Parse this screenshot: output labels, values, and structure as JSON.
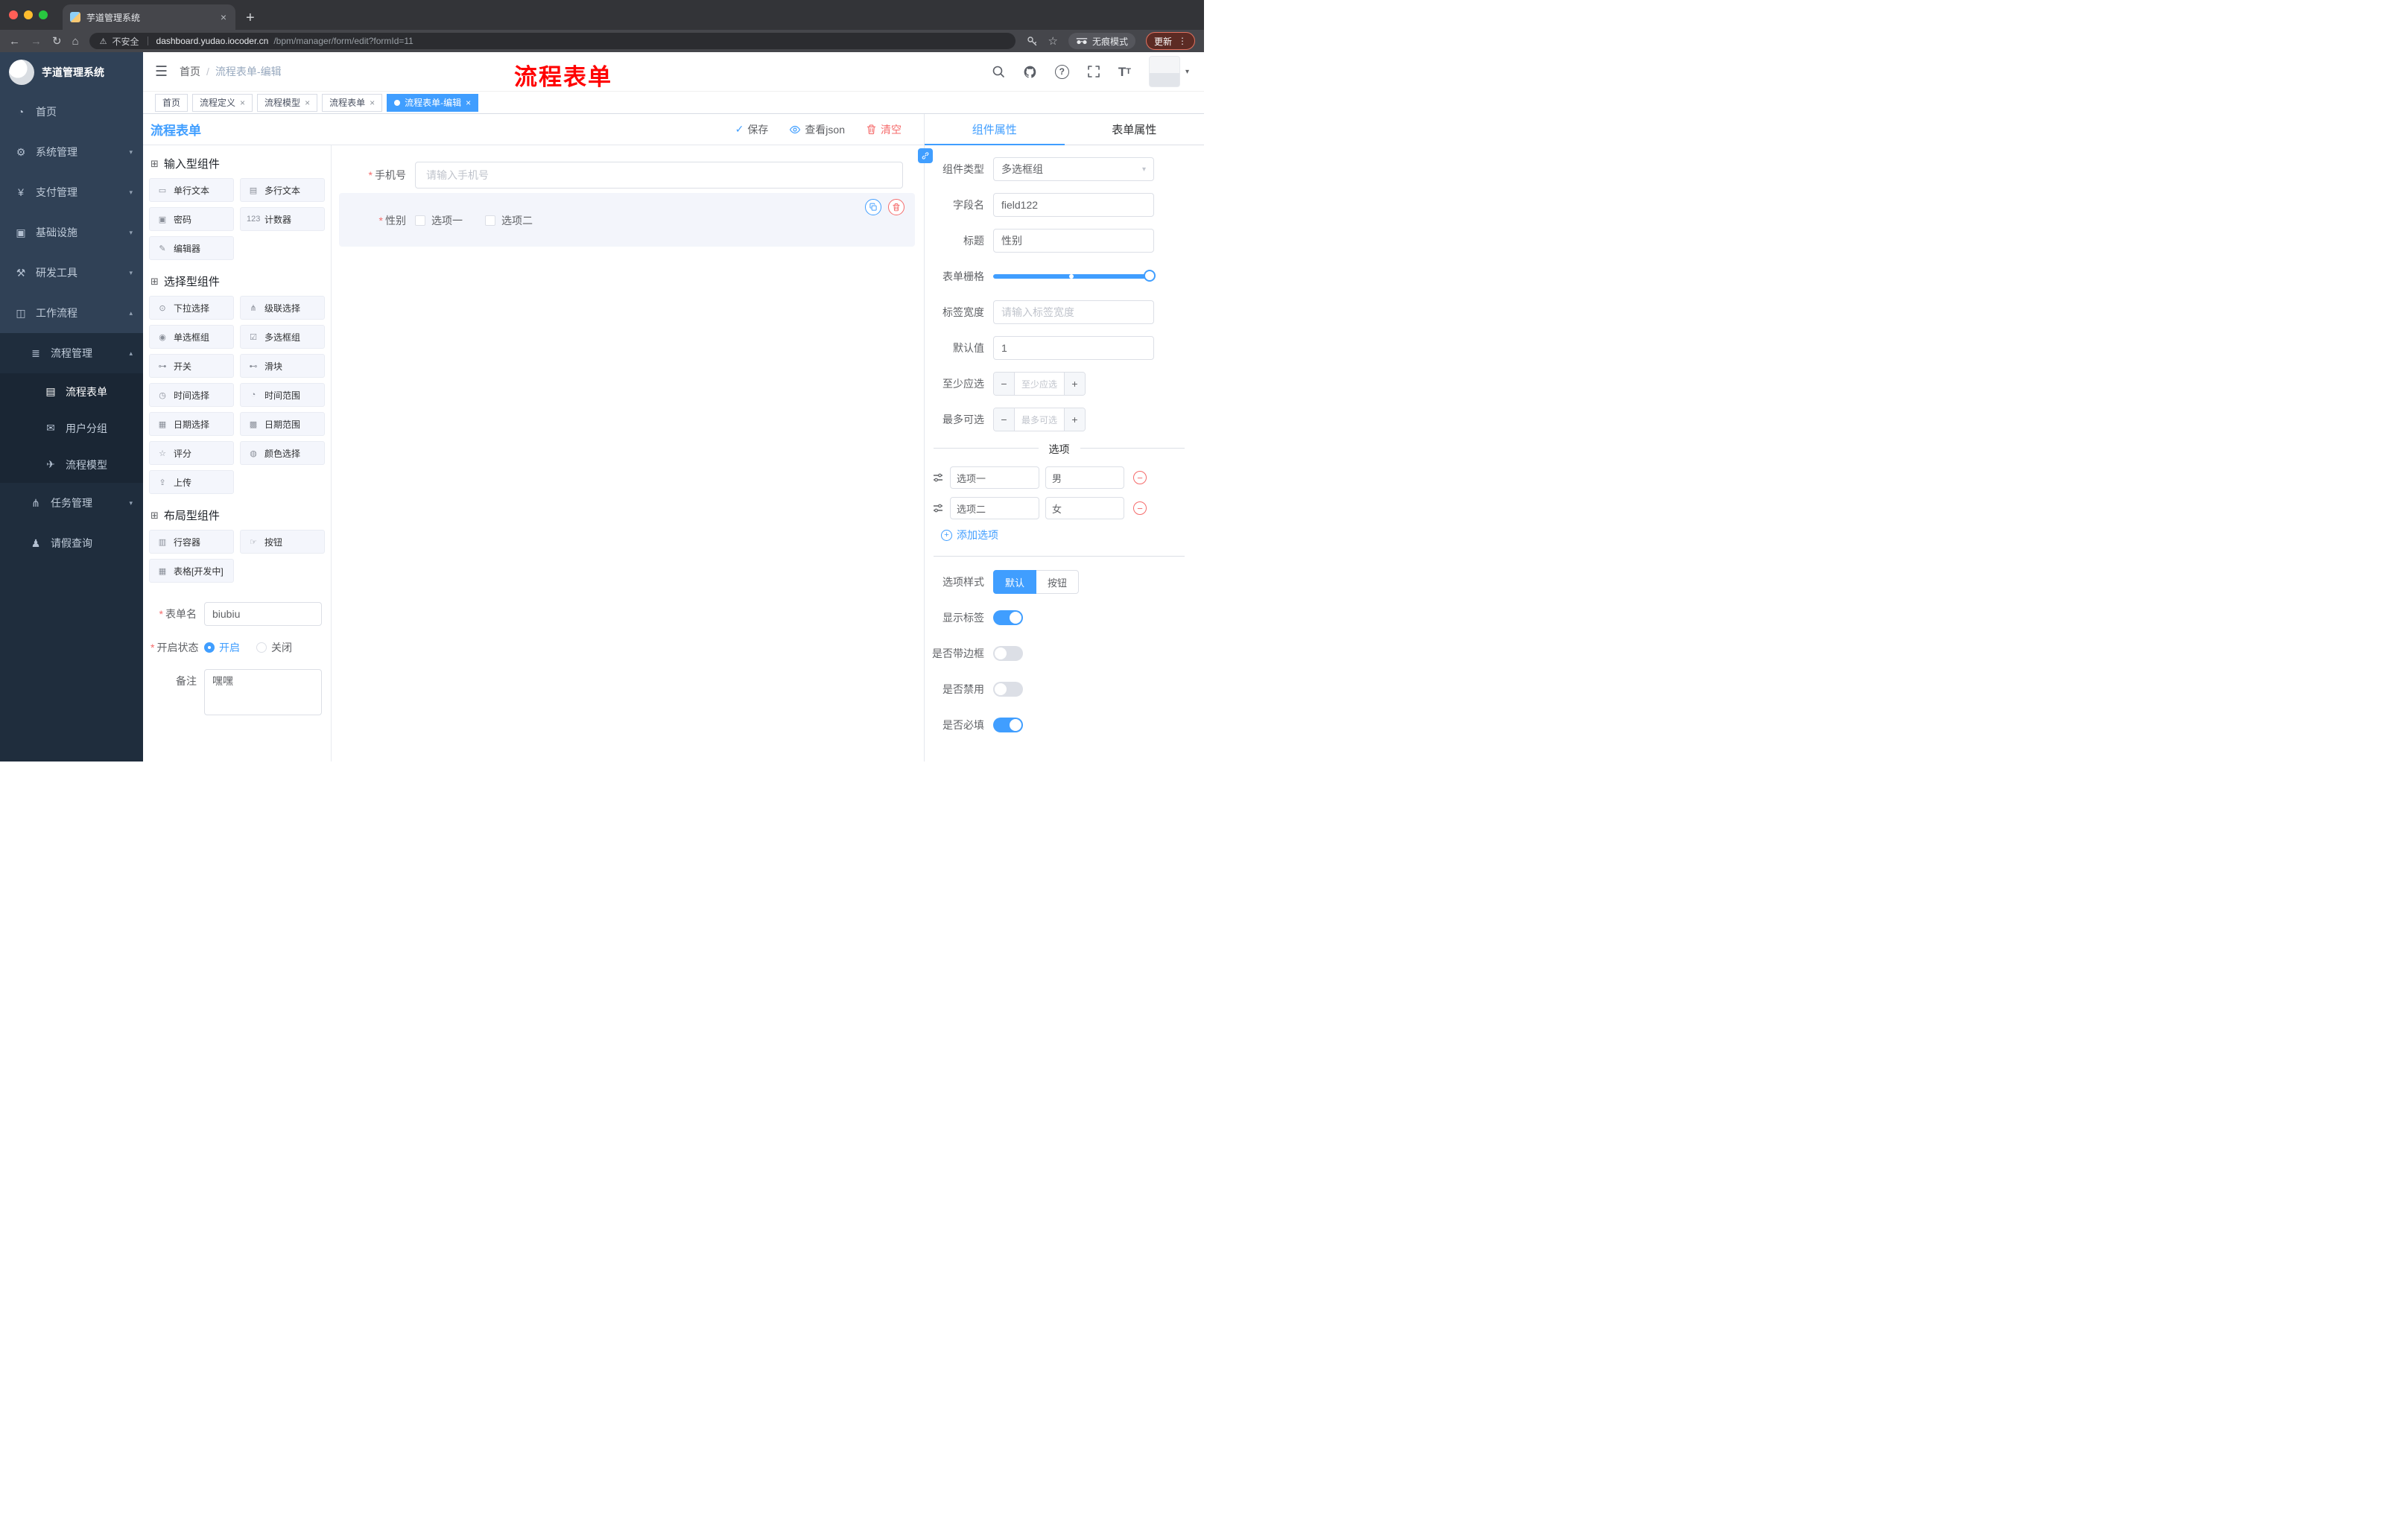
{
  "colors": {
    "accent": "#409eff",
    "danger": "#f56c6c",
    "annotation_red": "#ff0000",
    "sidebar_bg": "#304156",
    "submenu_bg": "#1f2d3d"
  },
  "browser": {
    "tab_title": "芋道管理系统",
    "security_label": "不安全",
    "url_host": "dashboard.yudao.iocoder.cn",
    "url_path": "/bpm/manager/form/edit?formId=11",
    "incognito_label": "无痕模式",
    "update_label": "更新"
  },
  "sidebar": {
    "logo_title": "芋道管理系统",
    "menu": [
      {
        "label": "首页",
        "glyph": "◔"
      },
      {
        "label": "系统管理",
        "glyph": "⚙"
      },
      {
        "label": "支付管理",
        "glyph": "¥"
      },
      {
        "label": "基础设施",
        "glyph": "▣"
      },
      {
        "label": "研发工具",
        "glyph": "⚒"
      },
      {
        "label": "工作流程",
        "glyph": "◫"
      }
    ],
    "submenu": {
      "group_label": "流程管理",
      "group_glyph": "≣",
      "children": [
        {
          "label": "流程表单",
          "glyph": "▤"
        },
        {
          "label": "用户分组",
          "glyph": "✉"
        },
        {
          "label": "流程模型",
          "glyph": "✈"
        }
      ],
      "task_label": "任务管理",
      "task_glyph": "⋔",
      "leave_label": "请假查询",
      "leave_glyph": "♟"
    }
  },
  "header": {
    "breadcrumb_home": "首页",
    "breadcrumb_current": "流程表单-编辑",
    "overlay_title": "流程表单"
  },
  "tags": [
    {
      "label": "首页"
    },
    {
      "label": "流程定义"
    },
    {
      "label": "流程模型"
    },
    {
      "label": "流程表单"
    },
    {
      "label": "流程表单-编辑"
    }
  ],
  "designer": {
    "panel_title": "流程表单",
    "save_label": "保存",
    "view_json_label": "查看json",
    "clear_label": "清空",
    "palette": {
      "groups": [
        {
          "title": "输入型组件",
          "items": [
            {
              "icon": "▭",
              "label": "单行文本"
            },
            {
              "icon": "▤",
              "label": "多行文本"
            },
            {
              "icon": "▣",
              "label": "密码"
            },
            {
              "icon": "123",
              "label": "计数器"
            },
            {
              "icon": "✎",
              "label": "编辑器"
            }
          ]
        },
        {
          "title": "选择型组件",
          "items": [
            {
              "icon": "⊙",
              "label": "下拉选择"
            },
            {
              "icon": "⋔",
              "label": "级联选择"
            },
            {
              "icon": "◉",
              "label": "单选框组"
            },
            {
              "icon": "☑",
              "label": "多选框组"
            },
            {
              "icon": "⊶",
              "label": "开关"
            },
            {
              "icon": "⊷",
              "label": "滑块"
            },
            {
              "icon": "◷",
              "label": "时间选择"
            },
            {
              "icon": "◔",
              "label": "时间范围"
            },
            {
              "icon": "▦",
              "label": "日期选择"
            },
            {
              "icon": "▩",
              "label": "日期范围"
            },
            {
              "icon": "☆",
              "label": "评分"
            },
            {
              "icon": "◍",
              "label": "颜色选择"
            },
            {
              "icon": "⇪",
              "label": "上传"
            }
          ]
        },
        {
          "title": "布局型组件",
          "items": [
            {
              "icon": "▥",
              "label": "行容器"
            },
            {
              "icon": "☞",
              "label": "按钮"
            },
            {
              "icon": "▦",
              "label": "表格[开发中]"
            }
          ]
        }
      ]
    },
    "form_config": {
      "name_label": "表单名",
      "name_value": "biubiu",
      "status_label": "开启状态",
      "status_on": "开启",
      "status_off": "关闭",
      "remark_label": "备注",
      "remark_value": "嘿嘿"
    },
    "canvas": {
      "phone_label": "手机号",
      "phone_placeholder": "请输入手机号",
      "gender_label": "性别",
      "gender_opt1": "选项一",
      "gender_opt2": "选项二"
    }
  },
  "props": {
    "tab_component": "组件属性",
    "tab_form": "表单属性",
    "type_label": "组件类型",
    "type_value": "多选框组",
    "field_label": "字段名",
    "field_value": "field122",
    "title_label": "标题",
    "title_value": "性别",
    "grid_label": "表单栅格",
    "label_width_label": "标签宽度",
    "label_width_placeholder": "请输入标签宽度",
    "default_label": "默认值",
    "default_value": "1",
    "min_label": "至少应选",
    "min_placeholder": "至少应选",
    "max_label": "最多可选",
    "max_placeholder": "最多可选",
    "options_title": "选项",
    "options": [
      {
        "label": "选项一",
        "value": "男"
      },
      {
        "label": "选项二",
        "value": "女"
      }
    ],
    "add_option_label": "添加选项",
    "style_label": "选项样式",
    "style_default": "默认",
    "style_button": "按钮",
    "switch_show_label": "显示标签",
    "switch_border": "是否带边框",
    "switch_disabled": "是否禁用",
    "switch_required": "是否必填"
  }
}
